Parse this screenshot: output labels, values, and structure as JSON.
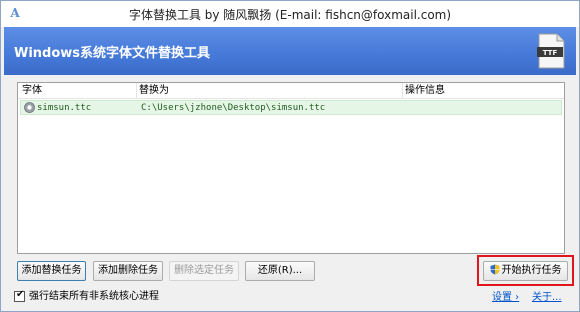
{
  "window": {
    "title": "字体替换工具 by 随风飘扬 (E-mail: fishcn@foxmail.com)",
    "icon_letter": "A"
  },
  "header": {
    "title": "Windows系统字体文件替换工具",
    "icon_label": "TTF",
    "icon_name": "ttf-file-icon"
  },
  "list": {
    "columns": [
      "字体",
      "替换为",
      "操作信息"
    ],
    "rows": [
      {
        "font": "simsun.ttc",
        "replace_with": "C:\\Users\\jzhone\\Desktop\\simsun.ttc",
        "info": ""
      }
    ]
  },
  "buttons": {
    "add_replace": "添加替换任务",
    "add_delete": "添加删除任务",
    "delete_selected": "删除选定任务",
    "restore": "还原(R)...",
    "start": "开始执行任务"
  },
  "footer": {
    "checkbox_label": "强行结束所有非系统核心进程",
    "checkbox_checked": true,
    "settings_link": "设置 ›",
    "about_link": "关于..."
  },
  "colors": {
    "header_bg": "#4a7fdc",
    "row_highlight": "#e6f6e6",
    "highlight_border": "#e0161c",
    "link": "#0055cc"
  }
}
